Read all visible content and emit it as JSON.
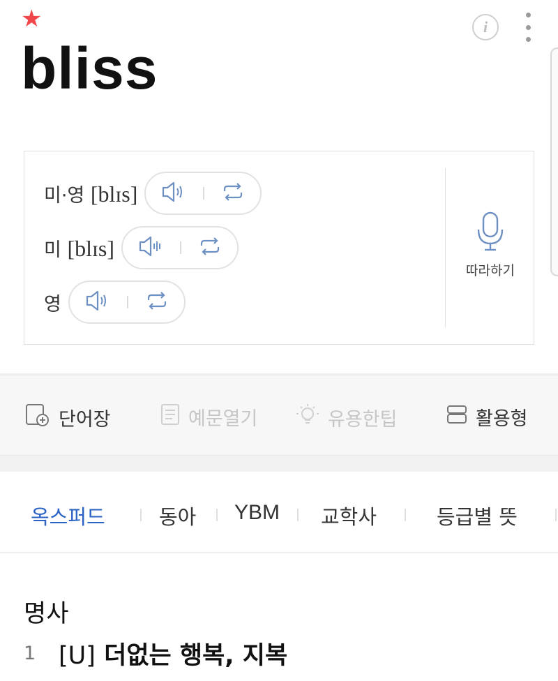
{
  "entry": {
    "word": "bliss",
    "favorite_icon": "star-icon",
    "accent_color": "#f0484a"
  },
  "header_actions": {
    "info_label": "i",
    "info_icon": "info-icon",
    "more_icon": "more-vertical-icon"
  },
  "pronunciation": {
    "rows": [
      {
        "label": "미·영 ",
        "ipa": "[blɪs]",
        "speaker_icon": "speaker-icon",
        "repeat_icon": "repeat-icon"
      },
      {
        "label": "미 ",
        "ipa": "[blɪs]",
        "speaker_icon": "speaker-active-icon",
        "repeat_icon": "repeat-icon"
      },
      {
        "label": "영",
        "ipa": "",
        "speaker_icon": "speaker-icon",
        "repeat_icon": "repeat-icon"
      }
    ],
    "follow_label": "따라하기",
    "follow_icon": "microphone-icon",
    "icon_color": "#6d8fc2"
  },
  "toolbar": {
    "items": [
      {
        "label": "단어장",
        "icon": "add-to-wordbook-icon",
        "enabled": true
      },
      {
        "label": "예문열기",
        "icon": "document-icon",
        "enabled": false
      },
      {
        "label": "유용한팁",
        "icon": "lightbulb-icon",
        "enabled": false
      },
      {
        "label": "활용형",
        "icon": "layers-icon",
        "enabled": true
      }
    ]
  },
  "tabs": {
    "items": [
      "옥스퍼드",
      "동아",
      "YBM",
      "교학사",
      "등급별 뜻"
    ],
    "active_index": 0,
    "active_color": "#2a62c4"
  },
  "definition": {
    "part_of_speech": "명사",
    "senses": [
      {
        "number": "1",
        "tag": "[U]",
        "text": " 더없는 행복, 지복"
      }
    ]
  }
}
